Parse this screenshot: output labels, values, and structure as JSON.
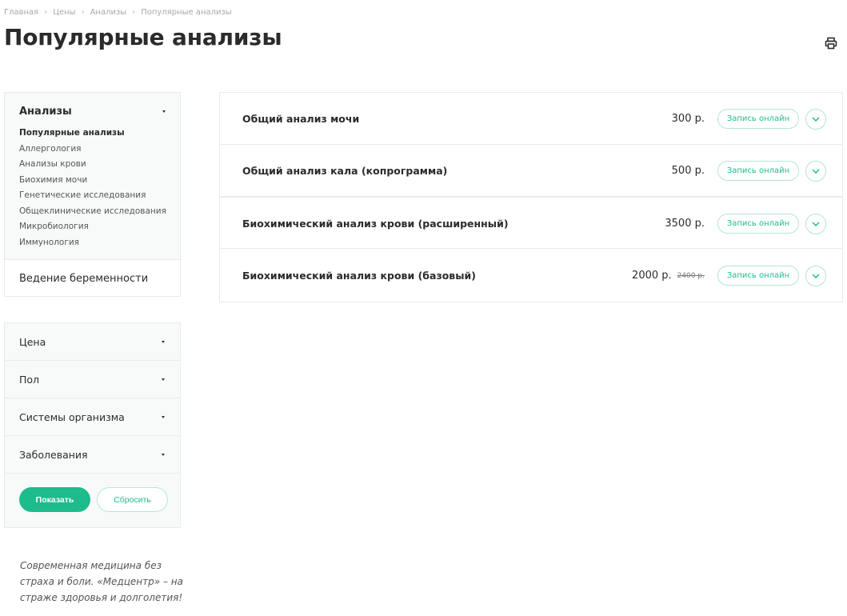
{
  "breadcrumb": [
    "Главная",
    "Цены",
    "Анализы",
    "Популярные анализы"
  ],
  "page_title": "Популярные анализы",
  "icons": {
    "print": "printer-icon",
    "separator": "chevron-right-icon",
    "expand": "chevron-down-icon",
    "dropdown": "caret-down-icon"
  },
  "categories": {
    "heading": "Анализы",
    "items": [
      {
        "label": "Популярные анализы",
        "active": true
      },
      {
        "label": "Аллергология",
        "active": false
      },
      {
        "label": "Анализы крови",
        "active": false
      },
      {
        "label": "Биохимия мочи",
        "active": false
      },
      {
        "label": "Генетические исследования",
        "active": false
      },
      {
        "label": "Общеклинические исследования",
        "active": false
      },
      {
        "label": "Микробиология",
        "active": false
      },
      {
        "label": "Иммунология",
        "active": false
      }
    ],
    "extra": "Ведение беременности"
  },
  "filters": {
    "rows": [
      "Цена",
      "Пол",
      "Системы организма",
      "Заболевания"
    ],
    "show_label": "Показать",
    "reset_label": "Сбросить"
  },
  "slogan": "Современная медицина без страха и боли. «Медцентр» – на страже здоровья и долголетия!",
  "products": [
    {
      "name": "Общий анализ мочи",
      "price": "300 р.",
      "old_price": "",
      "book_label": "Запись онлайн"
    },
    {
      "name": "Общий анализ кала (копрограмма)",
      "price": "500 р.",
      "old_price": "",
      "book_label": "Запись онлайн"
    },
    {
      "name": "Биохимический анализ крови (расширенный)",
      "price": "3500 р.",
      "old_price": "",
      "book_label": "Запись онлайн"
    },
    {
      "name": "Биохимический анализ крови (базовый)",
      "price": "2000 р.",
      "old_price": "2400 р.",
      "book_label": "Запись онлайн"
    }
  ],
  "colors": {
    "accent": "#1cbc8c",
    "accent_border": "#b4e6d3",
    "text": "#2b2b2b",
    "muted": "#a8a8a8",
    "panel_bg": "#f8faf9"
  }
}
